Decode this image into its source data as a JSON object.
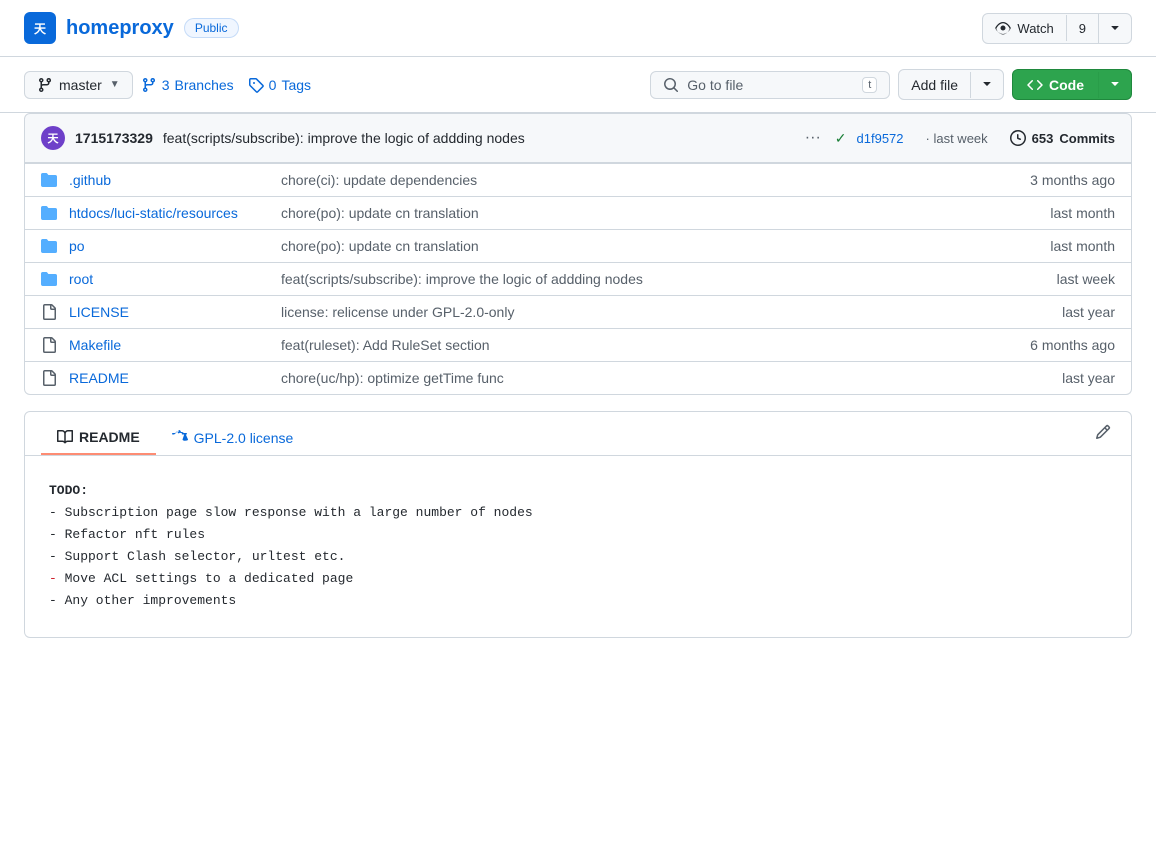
{
  "repo": {
    "name": "homeproxy",
    "visibility": "Public",
    "avatar_text": "天",
    "watch_label": "Watch",
    "watch_count": "9"
  },
  "toolbar": {
    "branch_label": "master",
    "branches_count": "3",
    "branches_label": "Branches",
    "tags_count": "0",
    "tags_label": "Tags",
    "go_to_file_placeholder": "Go to file",
    "go_to_file_key": "t",
    "add_file_label": "Add file",
    "code_label": "Code"
  },
  "commit": {
    "hash_short": "1715173329",
    "message": "feat(scripts/subscribe): improve the logic of addding nodes",
    "hash": "d1f9572",
    "time": "last week",
    "commits_count": "653",
    "commits_label": "Commits"
  },
  "files": [
    {
      "type": "folder",
      "name": ".github",
      "commit_msg": "chore(ci): update dependencies",
      "time": "3 months ago"
    },
    {
      "type": "folder",
      "name": "htdocs/luci-static/resources",
      "commit_msg": "chore(po): update cn translation",
      "time": "last month"
    },
    {
      "type": "folder",
      "name": "po",
      "commit_msg": "chore(po): update cn translation",
      "time": "last month"
    },
    {
      "type": "folder",
      "name": "root",
      "commit_msg": "feat(scripts/subscribe): improve the logic of addding nodes",
      "time": "last week"
    },
    {
      "type": "file",
      "name": "LICENSE",
      "commit_msg": "license: relicense under GPL-2.0-only",
      "time": "last year"
    },
    {
      "type": "file",
      "name": "Makefile",
      "commit_msg": "feat(ruleset): Add RuleSet section",
      "time": "6 months ago"
    },
    {
      "type": "file",
      "name": "README",
      "commit_msg": "chore(uc/hp): optimize getTime func",
      "time": "last year"
    }
  ],
  "readme": {
    "tab_label": "README",
    "license_label": "GPL-2.0 license",
    "content_lines": [
      "TODO:",
      "- Subscription page slow response with a large number of nodes",
      "- Refactor nft rules",
      "- Support Clash selector, urltest etc.",
      "- Move ACL settings to a dedicated page",
      "- Any other improvements"
    ]
  }
}
